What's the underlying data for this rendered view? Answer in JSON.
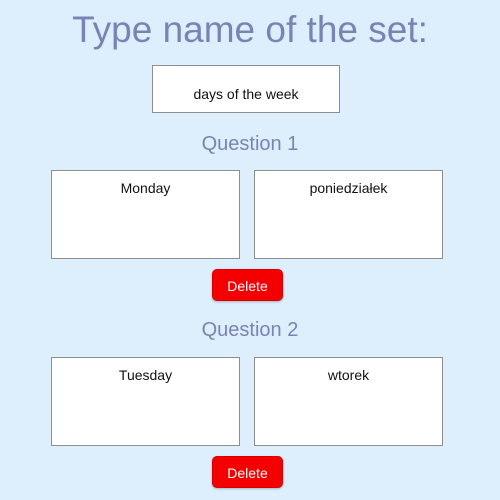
{
  "page": {
    "title": "Type name of the set:"
  },
  "set_name": {
    "value": "days of the week"
  },
  "questions": [
    {
      "heading": "Question 1",
      "term": "Monday",
      "definition": "poniedziałek",
      "delete_label": "Delete"
    },
    {
      "heading": "Question 2",
      "term": "Tuesday",
      "definition": "wtorek",
      "delete_label": "Delete"
    }
  ],
  "colors": {
    "background": "#ddeefc",
    "heading": "#7a84b4",
    "delete_button": "#f50000"
  }
}
